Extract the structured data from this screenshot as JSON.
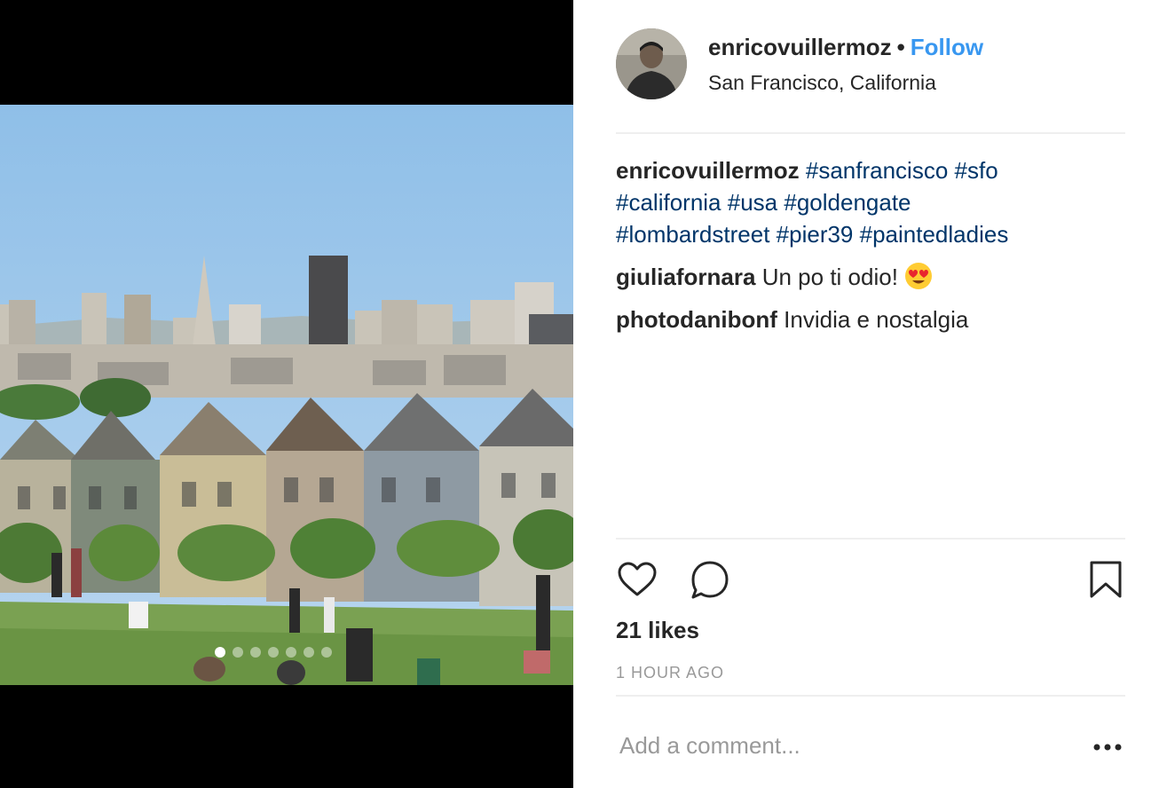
{
  "post": {
    "author": "enricovuillermoz",
    "separator": "•",
    "follow_label": "Follow",
    "location": "San Francisco, California"
  },
  "carousel": {
    "count": 7,
    "active_index": 0
  },
  "caption": {
    "user": "enricovuillermoz",
    "hashtags": [
      "#sanfrancisco",
      "#sfo",
      "#california",
      "#usa",
      "#goldengate",
      "#lombardstreet",
      "#pier39",
      "#paintedladies"
    ]
  },
  "comments": [
    {
      "user": "giuliafornara",
      "text": "Un po ti odio!",
      "emoji": "heart-eyes-emoji"
    },
    {
      "user": "photodanibonf",
      "text": "Invidia e nostalgia"
    }
  ],
  "actions": {
    "like_icon": "heart-icon",
    "comment_icon": "comment-bubble-icon",
    "save_icon": "bookmark-icon"
  },
  "likes_label": "21 likes",
  "timestamp": "1 HOUR AGO",
  "comment_input": {
    "placeholder": "Add a comment...",
    "value": ""
  },
  "colors": {
    "follow": "#3897f0",
    "hashtag": "#003569",
    "text": "#262626",
    "muted": "#999999",
    "divider": "#efefef"
  }
}
